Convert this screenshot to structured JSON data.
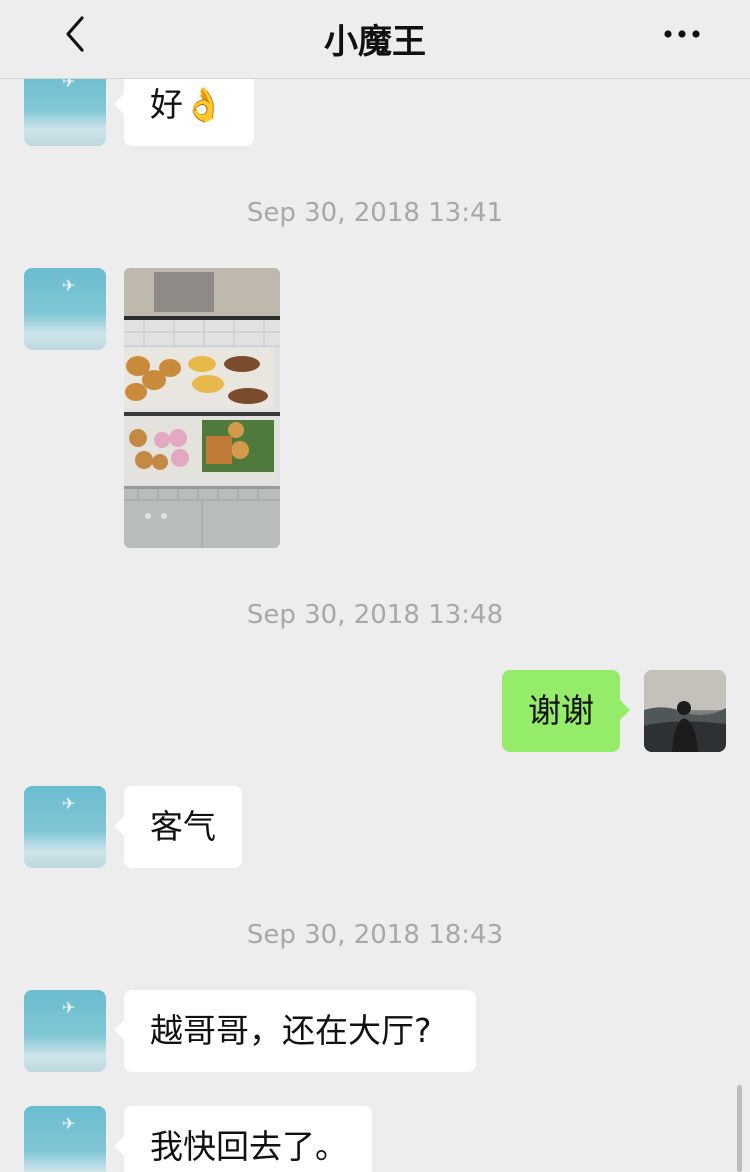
{
  "header": {
    "title": "小魔王",
    "back_icon": "chevron-left-icon",
    "more_icon": "more-dots-icon"
  },
  "messages": [
    {
      "side": "left",
      "text": "好👌"
    },
    {
      "timestamp": "Sep 30, 2018 13:41"
    },
    {
      "side": "left",
      "type": "image",
      "alt": "photo-message"
    },
    {
      "timestamp": "Sep 30, 2018 13:48"
    },
    {
      "side": "right",
      "text": "谢谢"
    },
    {
      "side": "left",
      "text": "客气"
    },
    {
      "timestamp": "Sep 30, 2018 18:43"
    },
    {
      "side": "left",
      "text": "越哥哥，还在大厅?"
    },
    {
      "side": "left",
      "text": "我快回去了。"
    }
  ],
  "colors": {
    "sent_bubble": "#95ec69",
    "received_bubble": "#ffffff",
    "background": "#ededed"
  }
}
